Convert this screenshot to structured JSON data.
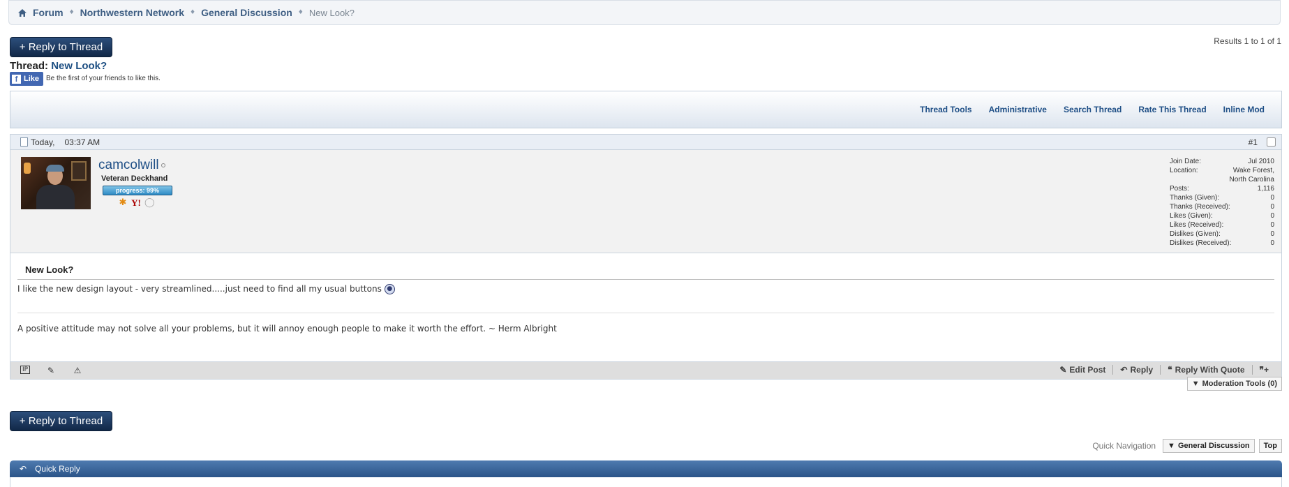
{
  "breadcrumb": {
    "items": [
      "Forum",
      "Northwestern Network",
      "General Discussion"
    ],
    "current": "New Look?"
  },
  "reply_button_label": "+ Reply to Thread",
  "results_text": "Results 1 to 1 of 1",
  "thread": {
    "prefix": "Thread:",
    "title": "New Look?"
  },
  "facebook": {
    "like_label": "Like",
    "text": "Be the first of your friends to like this."
  },
  "toolbar": [
    "Thread Tools",
    "Administrative",
    "Search Thread",
    "Rate This Thread",
    "Inline Mod"
  ],
  "post": {
    "date": "Today,",
    "time": "03:37 AM",
    "number": "#1",
    "username": "camcolwill",
    "user_title": "Veteran Deckhand",
    "progress_label": "progress: 99%",
    "progress": 0.99,
    "stats": [
      {
        "label": "Join Date:",
        "value": "Jul 2010"
      },
      {
        "label": "Location:",
        "value": "Wake Forest, North Carolina"
      },
      {
        "label": "Posts:",
        "value": "1,116"
      },
      {
        "label": "Thanks (Given):",
        "value": "0"
      },
      {
        "label": "Thanks (Received):",
        "value": "0"
      },
      {
        "label": "Likes (Given):",
        "value": "0"
      },
      {
        "label": "Likes (Received):",
        "value": "0"
      },
      {
        "label": "Dislikes (Given):",
        "value": "0"
      },
      {
        "label": "Dislikes (Received):",
        "value": "0"
      }
    ],
    "title": "New Look?",
    "text": "I like the new design layout - very streamlined.....just need to find all my usual buttons",
    "signature": "A positive attitude may not solve all your problems, but it will annoy enough people to make it worth the effort. ~ Herm Albright",
    "actions": [
      "Edit Post",
      "Reply",
      "Reply With Quote"
    ]
  },
  "moderation_tools_label": "Moderation Tools (0)",
  "quick_navigation": {
    "label": "Quick Navigation",
    "forum": "General Discussion",
    "top": "Top"
  },
  "quick_reply_label": "Quick Reply",
  "colors": {
    "link": "#1f4f86",
    "button_dark": "#112847",
    "quick_reply_bar": "#2b5488"
  }
}
